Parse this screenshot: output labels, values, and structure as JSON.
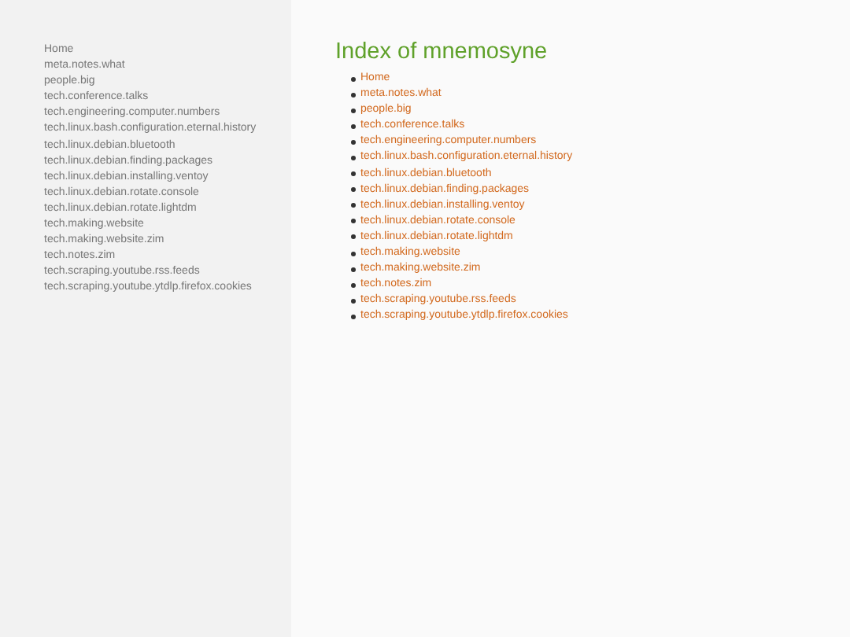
{
  "sidebar": {
    "items": [
      "Home",
      "meta.notes.what",
      "people.big",
      "tech.conference.talks",
      "tech.engineering.computer.numbers",
      "tech.linux.bash.configuration.eternal.history",
      "tech.linux.debian.bluetooth",
      "tech.linux.debian.finding.packages",
      "tech.linux.debian.installing.ventoy",
      "tech.linux.debian.rotate.console",
      "tech.linux.debian.rotate.lightdm",
      "tech.making.website",
      "tech.making.website.zim",
      "tech.notes.zim",
      "tech.scraping.youtube.rss.feeds",
      "tech.scraping.youtube.ytdlp.firefox.cookies"
    ]
  },
  "main": {
    "title": "Index of mnemosyne",
    "links": [
      "Home",
      "meta.notes.what",
      "people.big",
      "tech.conference.talks",
      "tech.engineering.computer.numbers",
      "tech.linux.bash.configuration.eternal.history",
      "tech.linux.debian.bluetooth",
      "tech.linux.debian.finding.packages",
      "tech.linux.debian.installing.ventoy",
      "tech.linux.debian.rotate.console",
      "tech.linux.debian.rotate.lightdm",
      "tech.making.website",
      "tech.making.website.zim",
      "tech.notes.zim",
      "tech.scraping.youtube.rss.feeds",
      "tech.scraping.youtube.ytdlp.firefox.cookies"
    ]
  }
}
